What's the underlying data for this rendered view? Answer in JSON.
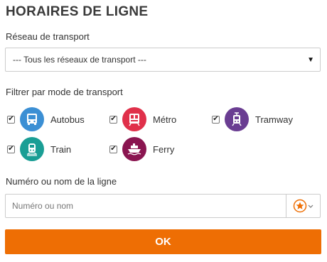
{
  "title": "HORAIRES DE LIGNE",
  "network": {
    "label": "Réseau de transport",
    "selected": "--- Tous les réseaux de transport ---"
  },
  "filter": {
    "label": "Filtrer par mode de transport",
    "modes": [
      {
        "label": "Autobus",
        "icon": "bus-icon",
        "color": "#3b8fd4",
        "checked": true
      },
      {
        "label": "Métro",
        "icon": "metro-icon",
        "color": "#e0304a",
        "checked": true
      },
      {
        "label": "Tramway",
        "icon": "tram-icon",
        "color": "#6a3d92",
        "checked": true
      },
      {
        "label": "Train",
        "icon": "train-icon",
        "color": "#1a9e95",
        "checked": true
      },
      {
        "label": "Ferry",
        "icon": "ferry-icon",
        "color": "#8a1550",
        "checked": true
      }
    ]
  },
  "line": {
    "label": "Numéro ou nom de la ligne",
    "placeholder": "Numéro ou nom",
    "favorites_icon": "star-icon",
    "favorites_color": "#ee6e04"
  },
  "submit": {
    "label": "OK",
    "color": "#ee6e04"
  }
}
